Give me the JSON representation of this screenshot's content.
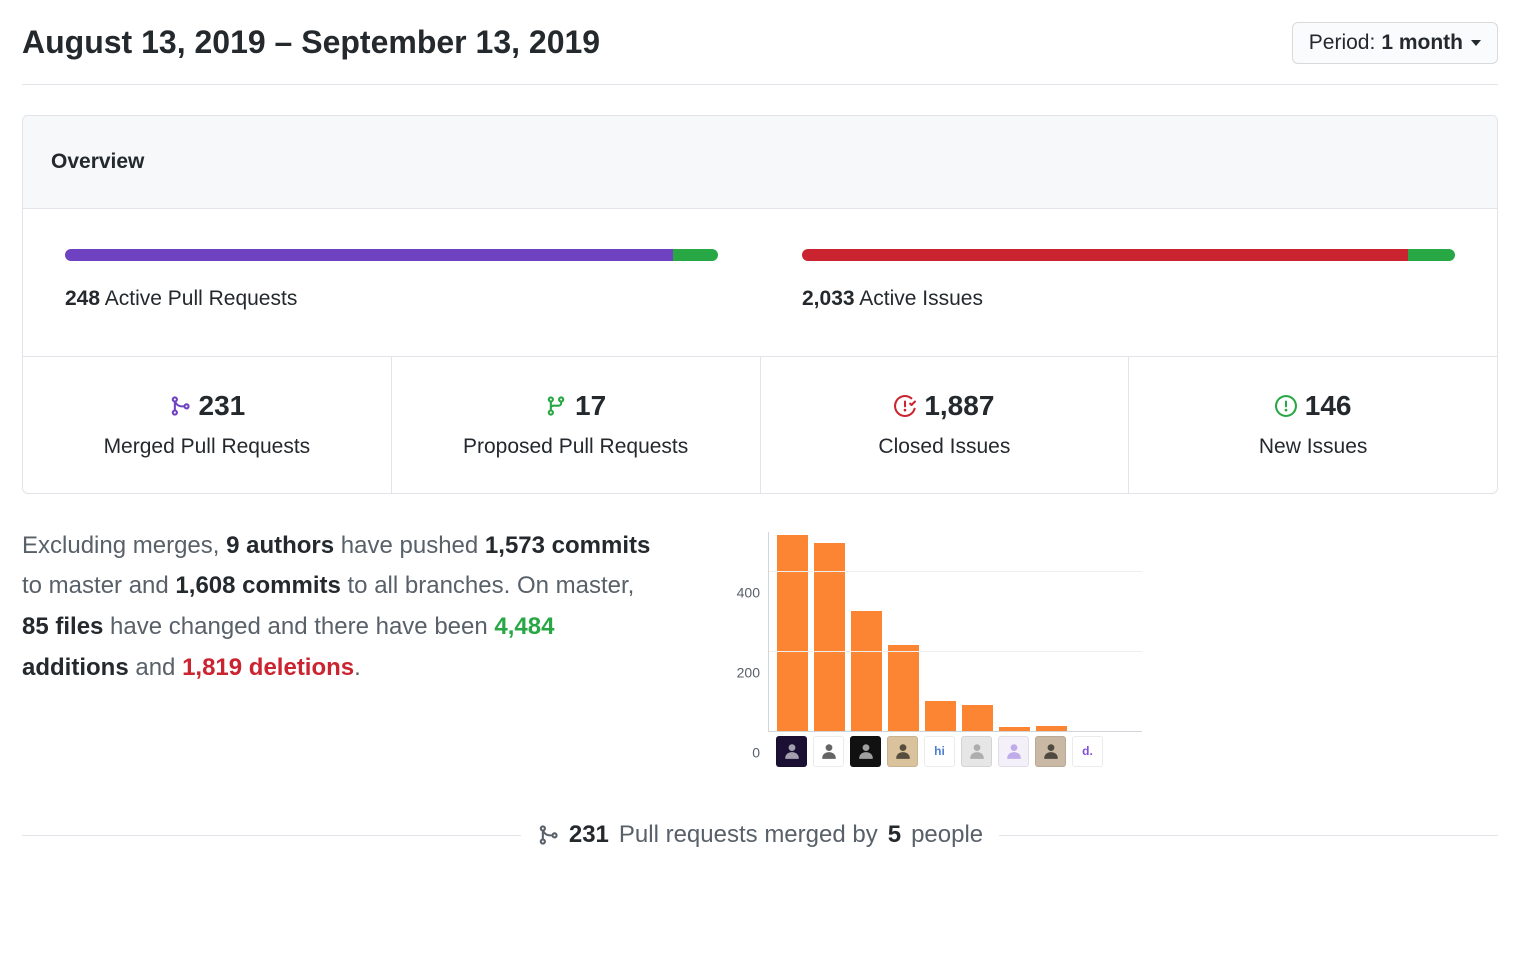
{
  "header": {
    "date_range": "August 13, 2019 – September 13, 2019",
    "period_label": "Period:",
    "period_value": "1 month"
  },
  "overview": {
    "title": "Overview",
    "pull_requests": {
      "count": "248",
      "label": "Active Pull Requests",
      "merged_pct": 93.1,
      "proposed_pct": 6.9
    },
    "issues": {
      "count": "2,033",
      "label": "Active Issues",
      "closed_pct": 92.8,
      "new_pct": 7.2
    }
  },
  "stats": {
    "merged_prs": {
      "count": "231",
      "label": "Merged Pull Requests"
    },
    "proposed_prs": {
      "count": "17",
      "label": "Proposed Pull Requests"
    },
    "closed_issues": {
      "count": "1,887",
      "label": "Closed Issues"
    },
    "new_issues": {
      "count": "146",
      "label": "New Issues"
    }
  },
  "summary": {
    "prefix": "Excluding merges, ",
    "authors": "9 authors",
    "t1": " have pushed ",
    "commits_master": "1,573 commits",
    "t2": " to master and ",
    "commits_all": "1,608 commits",
    "t3": " to all branches. On master, ",
    "files": "85 files",
    "t4": " have changed and there have been ",
    "additions": "4,484",
    "additions_label": " additions",
    "t5": " and ",
    "deletions": "1,819 deletions",
    "t6": "."
  },
  "chart_data": {
    "type": "bar",
    "categories": [
      "a1",
      "a2",
      "a3",
      "a4",
      "a5",
      "a6",
      "a7",
      "a8",
      "a9"
    ],
    "values": [
      490,
      470,
      300,
      215,
      75,
      65,
      8,
      12,
      0
    ],
    "title": "",
    "xlabel": "",
    "ylabel": "",
    "ylim": [
      0,
      500
    ],
    "yticks": [
      0,
      200,
      400
    ]
  },
  "avatars": [
    {
      "bg": "#1b1033",
      "fg": "#ffffff",
      "label": ""
    },
    {
      "bg": "#ffffff",
      "fg": "#000000",
      "label": ""
    },
    {
      "bg": "#111111",
      "fg": "#ffffff",
      "label": ""
    },
    {
      "bg": "#d9c29c",
      "fg": "#000000",
      "label": ""
    },
    {
      "bg": "#ffffff",
      "fg": "#4d7fd1",
      "label": "hi"
    },
    {
      "bg": "#e6e6e6",
      "fg": "#888888",
      "label": ""
    },
    {
      "bg": "#f4f0fa",
      "fg": "#9f7ee0",
      "label": ""
    },
    {
      "bg": "#c9b8a3",
      "fg": "#000000",
      "label": ""
    },
    {
      "bg": "#ffffff",
      "fg": "#8250df",
      "label": "d."
    }
  ],
  "footer": {
    "count": "231",
    "t1": "Pull requests merged by",
    "people": "5",
    "t2": "people"
  },
  "colors": {
    "purple": "#6f42c1",
    "green": "#28a745",
    "red": "#cb2431"
  }
}
